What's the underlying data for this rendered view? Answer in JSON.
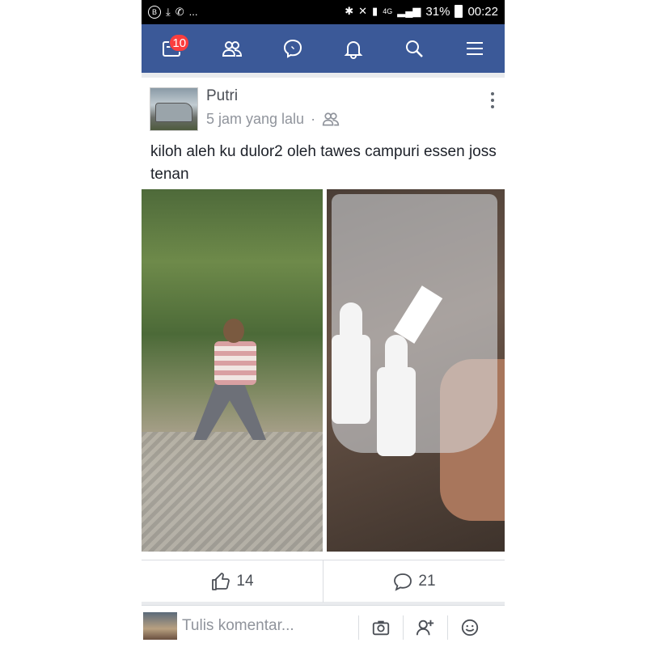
{
  "status_bar": {
    "left_icons": [
      "b-badge-icon",
      "download-icon",
      "whatsapp-icon",
      "more-dots-icon"
    ],
    "left_text": "...",
    "network": "4G",
    "battery": "31%",
    "time": "00:22"
  },
  "nav": {
    "notifications_count": "10",
    "items": [
      "news-feed-icon",
      "friends-icon",
      "messenger-icon",
      "bell-icon",
      "search-icon",
      "menu-icon"
    ]
  },
  "post": {
    "author": "Putri",
    "time": "5 jam yang lalu",
    "separator": "·",
    "text": "kiloh aleh ku dulor2 oleh tawes campuri essen joss tenan",
    "likes": "14",
    "comments": "21"
  },
  "comment_bar": {
    "placeholder": "Tulis komentar..."
  },
  "colors": {
    "nav_bg": "#3b5998",
    "badge": "#fa3e3e"
  }
}
